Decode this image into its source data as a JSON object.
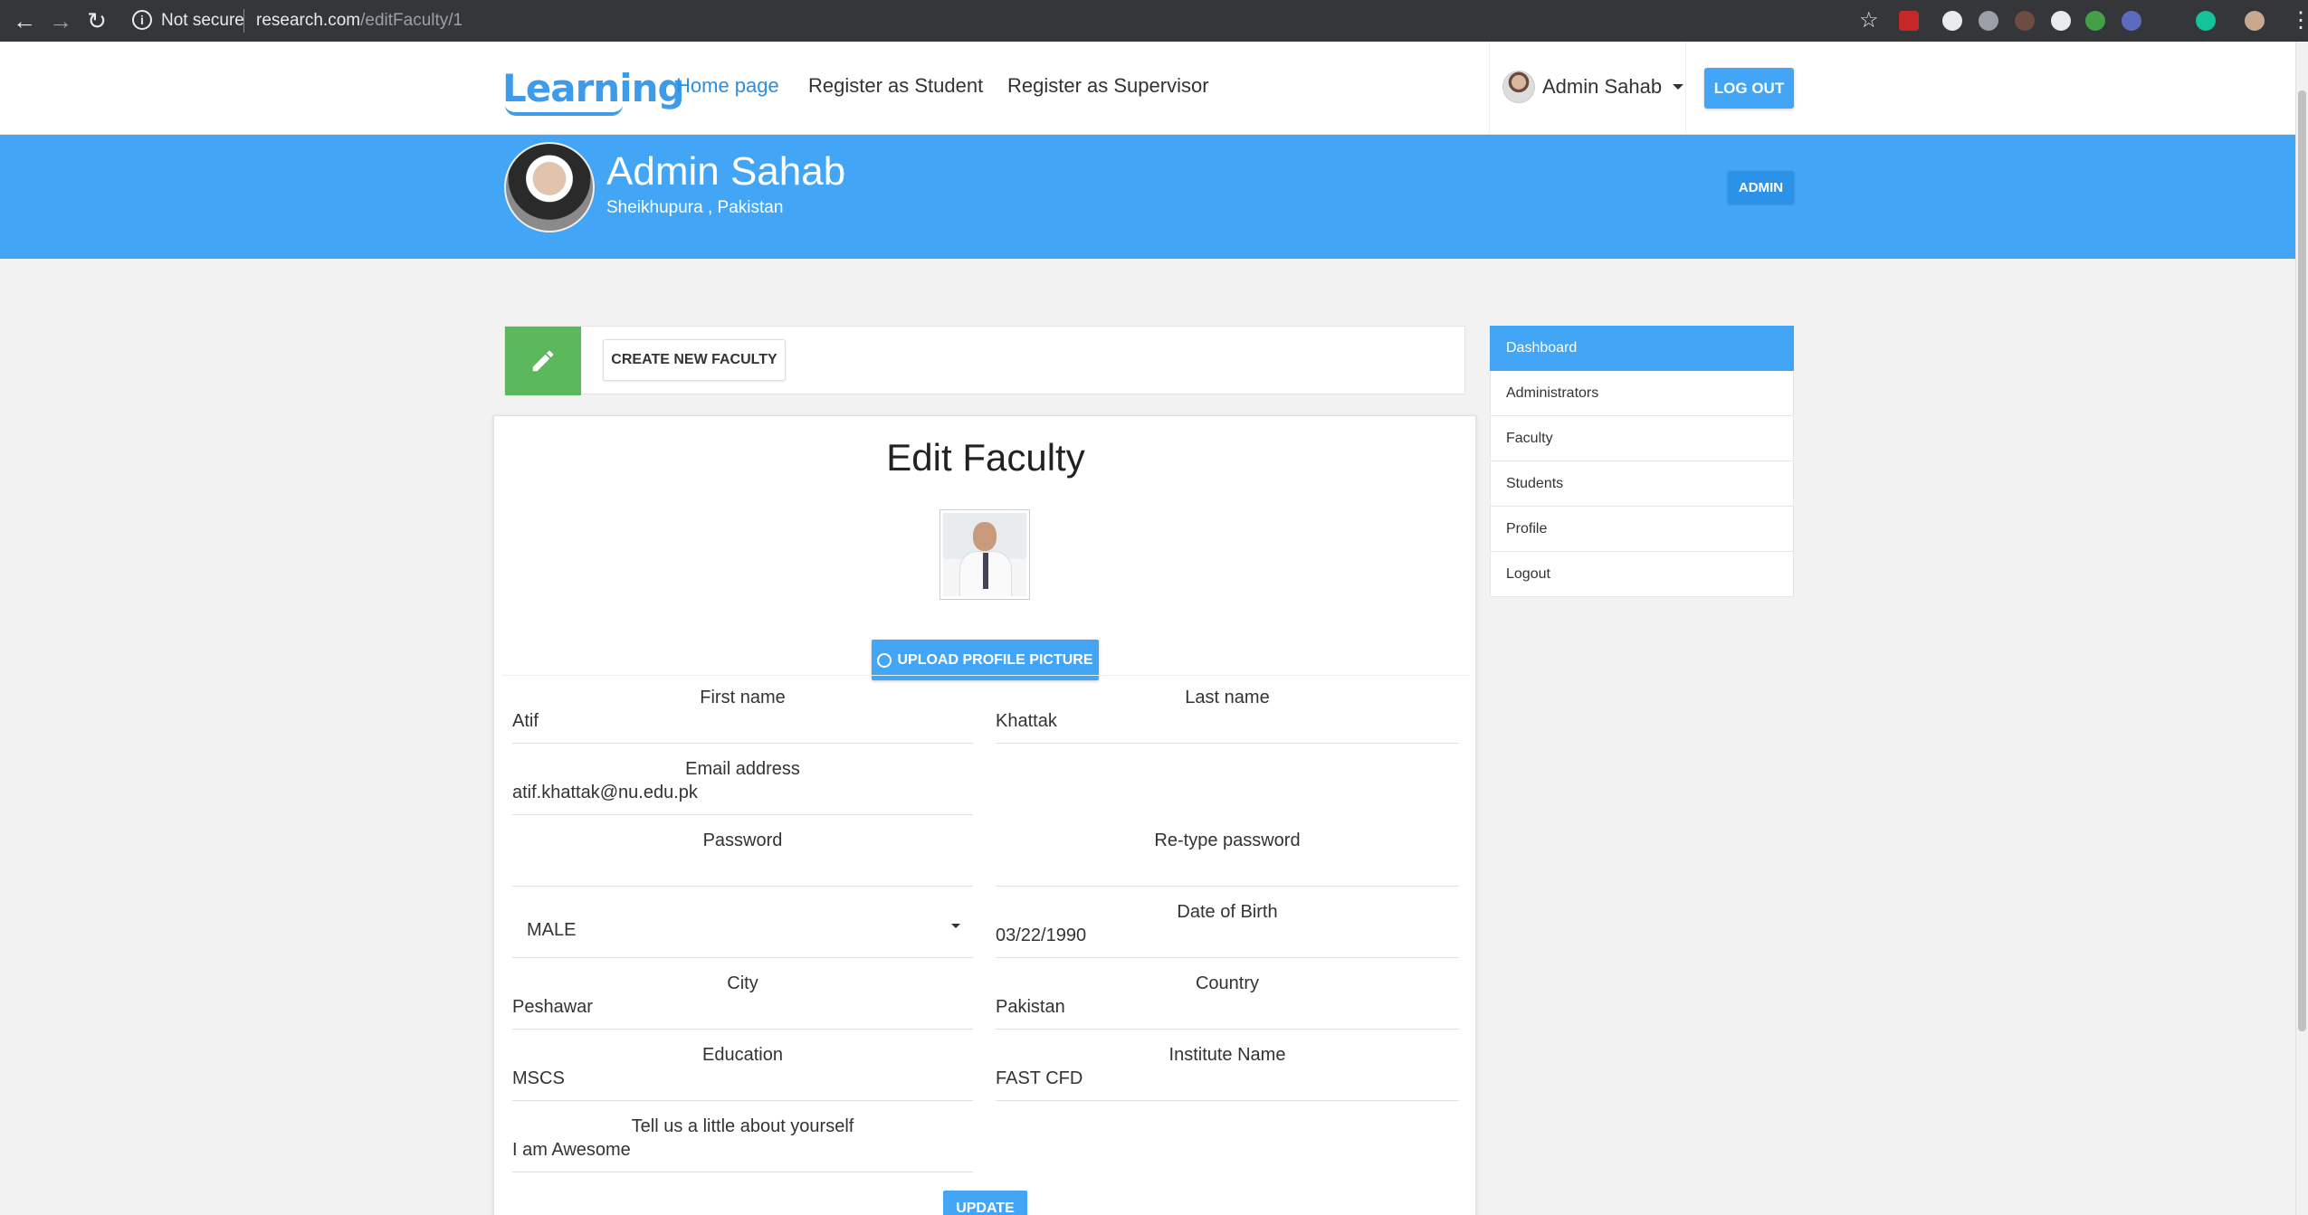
{
  "browser": {
    "security_label": "Not secure",
    "url_host": "research.com",
    "url_path": "/editFaculty/1"
  },
  "nav": {
    "logo": "Learning",
    "links": [
      "Home page",
      "Register as Student",
      "Register as Supervisor"
    ],
    "user_name": "Admin Sahab",
    "logout_label": "LOG OUT"
  },
  "hero": {
    "name": "Admin Sahab",
    "location": "Sheikhupura , Pakistan",
    "badge": "ADMIN"
  },
  "actionbar": {
    "create_label": "CREATE NEW FACULTY"
  },
  "form": {
    "title": "Edit Faculty",
    "upload_label": "UPLOAD PROFILE PICTURE",
    "first_name": {
      "value": "Atif",
      "label": "First name"
    },
    "last_name": {
      "value": "Khattak",
      "label": "Last name"
    },
    "email": {
      "value": "atif.khattak@nu.edu.pk",
      "label": "Email address"
    },
    "password": {
      "value": "",
      "label": "Password"
    },
    "retype_password": {
      "value": "",
      "label": "Re-type password"
    },
    "gender": {
      "value": "MALE"
    },
    "dob": {
      "value": "03/22/1990",
      "label": "Date of Birth"
    },
    "city": {
      "value": "Peshawar",
      "label": "City"
    },
    "country": {
      "value": "Pakistan",
      "label": "Country"
    },
    "education": {
      "value": "MSCS",
      "label": "Education"
    },
    "institute": {
      "value": "FAST CFD",
      "label": "Institute Name"
    },
    "about": {
      "value": "I am Awesome",
      "label": "Tell us a little about yourself"
    },
    "update_label": "UPDATE"
  },
  "sidebar": {
    "items": [
      "Dashboard",
      "Administrators",
      "Faculty",
      "Students",
      "Profile",
      "Logout"
    ]
  },
  "colors": {
    "primary": "#43a5f5",
    "success": "#5cb85c",
    "chrome": "#35363a"
  }
}
